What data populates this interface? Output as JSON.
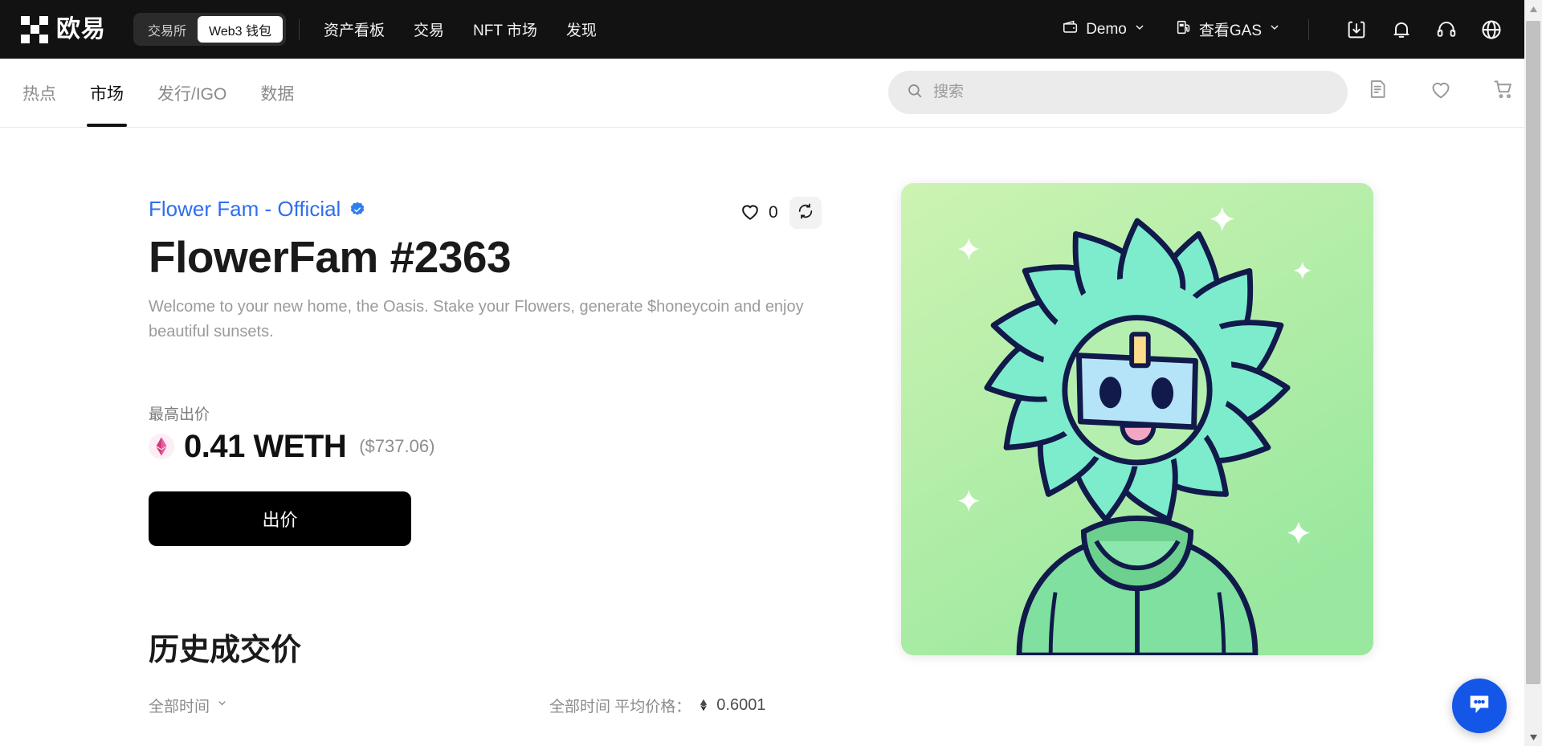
{
  "brand": {
    "logo_text": "欧易",
    "logo_icon": "okx-logo-icon"
  },
  "topnav": {
    "segments": [
      {
        "label": "交易所",
        "active": false
      },
      {
        "label": "Web3 钱包",
        "active": true
      }
    ],
    "links": [
      {
        "label": "资产看板"
      },
      {
        "label": "交易"
      },
      {
        "label": "NFT 市场"
      },
      {
        "label": "发现"
      }
    ],
    "account": {
      "label": "Demo",
      "icon": "wallet-icon",
      "chevron": "chevron-down-icon"
    },
    "gas": {
      "label": "查看GAS",
      "icon": "gas-pump-icon",
      "chevron": "chevron-down-icon"
    },
    "icons": [
      {
        "name": "download-icon"
      },
      {
        "name": "bell-icon"
      },
      {
        "name": "headset-icon"
      },
      {
        "name": "globe-icon"
      }
    ]
  },
  "subnav": {
    "tabs": [
      {
        "label": "热点",
        "active": false
      },
      {
        "label": "市场",
        "active": true
      },
      {
        "label": "发行/IGO",
        "active": false
      },
      {
        "label": "数据",
        "active": false
      }
    ],
    "search": {
      "placeholder": "搜索",
      "value": "",
      "icon": "search-icon"
    },
    "icons": [
      {
        "name": "orders-document-icon"
      },
      {
        "name": "heart-icon"
      },
      {
        "name": "cart-icon"
      }
    ]
  },
  "detail": {
    "collection_name": "Flower Fam - Official",
    "verified_icon": "verified-badge-icon",
    "title": "FlowerFam #2363",
    "description": "Welcome to your new home, the Oasis. Stake your Flowers, generate $honeycoin and enjoy beautiful sunsets.",
    "like_count": "0",
    "like_icon": "heart-icon",
    "refresh_icon": "refresh-icon",
    "price_label": "最高出价",
    "price_amount": "0.41 WETH",
    "price_usd": "($737.06)",
    "price_token_icon": "weth-icon",
    "bid_button": "出价"
  },
  "history": {
    "title": "历史成交价",
    "time_filter": "全部时间",
    "time_filter_chevron": "chevron-down-icon",
    "avg_label": "全部时间 平均价格：",
    "avg_icon": "eth-icon",
    "avg_value": "0.6001"
  },
  "artwork": {
    "name": "flowerfam-nft-artwork",
    "background": "#c9f0ae",
    "petal_color": "#7deccd",
    "petal_shade": "#62ddbc",
    "outline": "#111a4a",
    "face_color": "#b5e3f7",
    "body_color": "#7fe0a0",
    "body_shade": "#6cd08e",
    "tag_color": "#fbdc8a",
    "tongue_color": "#f4a7c4",
    "sparkle_color": "#ffffff"
  },
  "fab": {
    "name": "chat-bubble-button",
    "icon": "chat-bubble-icon",
    "color": "#1356e8"
  },
  "scrollbar": {
    "up_icon": "scroll-up-arrow-icon",
    "down_icon": "scroll-down-arrow-icon"
  }
}
